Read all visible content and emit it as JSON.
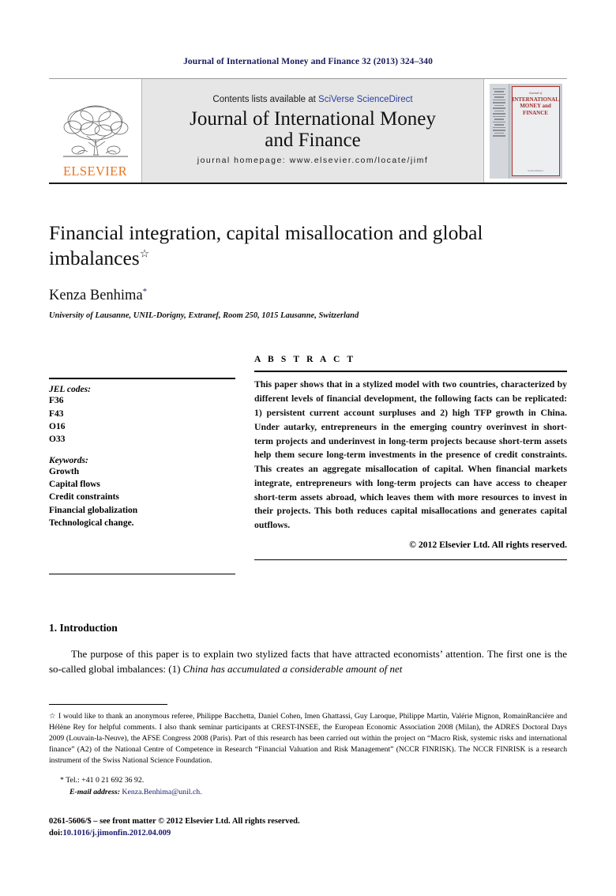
{
  "running_head": "Journal of International Money and Finance 32 (2013) 324–340",
  "masthead": {
    "publisher_name": "ELSEVIER",
    "publisher_logo_icon": "elsevier-tree-icon",
    "contents_prefix": "Contents lists available at ",
    "sciencedirect_link": "SciVerse ScienceDirect",
    "journal_title": "Journal of International Money and Finance",
    "homepage_line": "journal homepage: www.elsevier.com/locate/jimf",
    "cover": {
      "kicker": "Journal of",
      "title": "INTERNATIONAL MONEY and FINANCE",
      "footer": "ScienceDirect"
    }
  },
  "article": {
    "title": "Financial integration, capital misallocation and global imbalances",
    "title_footnote_marker": "☆",
    "author": "Kenza Benhima",
    "author_footnote_marker": "*",
    "affiliation": "University of Lausanne, UNIL-Dorigny, Extranef, Room 250, 1015 Lausanne, Switzerland"
  },
  "article_info": {
    "jel_heading": "JEL codes:",
    "jel_codes": [
      "F36",
      "F43",
      "O16",
      "O33"
    ],
    "keywords_heading": "Keywords:",
    "keywords": [
      "Growth",
      "Capital flows",
      "Credit constraints",
      "Financial globalization",
      "Technological change."
    ]
  },
  "abstract": {
    "heading": "A B S T R A C T",
    "text": "This paper shows that in a stylized model with two countries, characterized by different levels of financial development, the following facts can be replicated: 1) persistent current account surpluses and 2) high TFP growth in China. Under autarky, entrepreneurs in the emerging country overinvest in short-term projects and underinvest in long-term projects because short-term assets help them secure long-term investments in the presence of credit constraints. This creates an aggregate misallocation of capital. When financial markets integrate, entrepreneurs with long-term projects can have access to cheaper short-term assets abroad, which leaves them with more resources to invest in their projects. This both reduces capital misallocations and generates capital outflows.",
    "copyright": "© 2012 Elsevier Ltd. All rights reserved."
  },
  "body": {
    "section_number_title": "1. Introduction",
    "paragraph_plain_1": "The purpose of this paper is to explain two stylized facts that have attracted economists’ attention. The first one is the so-called global imbalances: (1) ",
    "paragraph_italic_1": "China has accumulated a considerable amount of net"
  },
  "footnotes": {
    "star_marker": "☆",
    "acknowledgement": "I would like to thank an anonymous referee, Philippe Bacchetta, Daniel Cohen, Imen Ghattassi, Guy Laroque, Philippe Martin, Valérie Mignon, RomainRancière and Hélène Rey for helpful comments. I also thank seminar participants at CREST-INSEE, the European Economic Association 2008 (Milan), the ADRES Doctoral Days 2009 (Louvain-la-Neuve), the AFSE Congress 2008 (Paris). Part of this research has been carried out within the project on “Macro Risk, systemic risks and international finance” (A2) of the National Centre of Competence in Research “Financial Valuation and Risk Management” (NCCR FINRISK). The NCCR FINRISK is a research instrument of the Swiss National Science Foundation.",
    "tel_marker": "*",
    "tel": "Tel.: +41 0 21 692 36 92.",
    "email_label": "E-mail address:",
    "email_address": "Kenza.Benhima@unil.ch."
  },
  "imprint": {
    "front_matter": "0261-5606/$ – see front matter © 2012 Elsevier Ltd. All rights reserved.",
    "doi_label": "doi:",
    "doi_value": "10.1016/j.jimonfin.2012.04.009"
  },
  "colors": {
    "running_head": "#1a1a5e",
    "link_blue": "#2b3f9e",
    "elsevier_orange": "#e87722",
    "masthead_bg": "#e6e6e6",
    "cover_red": "#a32b2b"
  }
}
